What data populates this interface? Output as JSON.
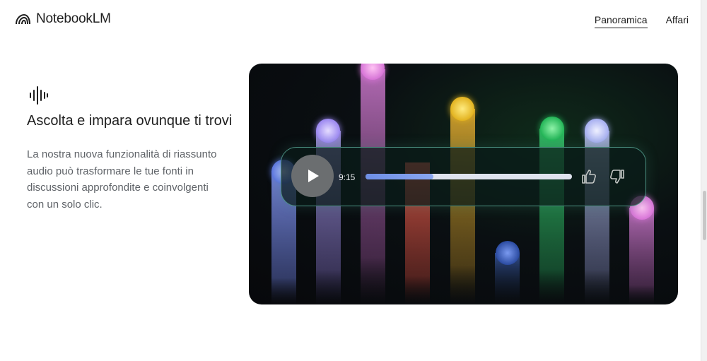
{
  "header": {
    "logo_text": "NotebookLM",
    "nav": [
      {
        "label": "Panoramica",
        "active": true
      },
      {
        "label": "Affari",
        "active": false
      }
    ]
  },
  "feature": {
    "icon": "audio-waveform-icon",
    "title": "Ascolta e impara ovunque ti trovi",
    "description": "La nostra nuova funzionalità di riassunto audio può trasformare le tue fonti in discussioni approfondite e coinvolgenti con un solo clic."
  },
  "player": {
    "time": "9:15",
    "progress": 0.33,
    "play_icon": "play-icon",
    "like_icon": "thumbs-up-icon",
    "dislike_icon": "thumbs-down-icon"
  },
  "colors": {
    "accent_progress": "#7b9bec",
    "player_border": "#4a8f80"
  }
}
